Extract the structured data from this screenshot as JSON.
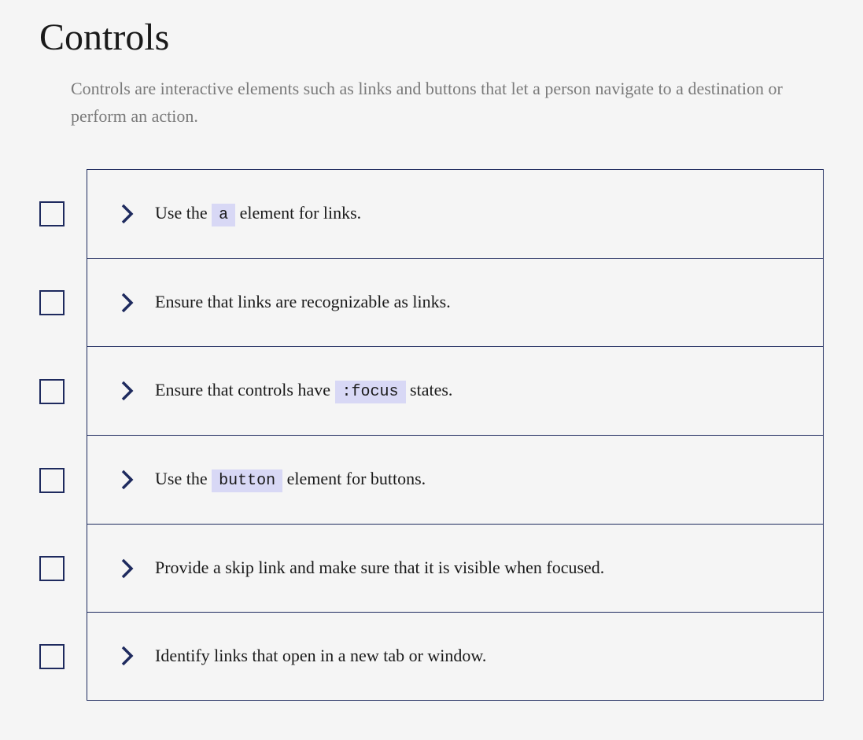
{
  "heading": "Controls",
  "description": "Controls are interactive elements such as links and buttons that let a person navigate to a destination or perform an action.",
  "items": [
    {
      "segments": [
        {
          "t": "text",
          "v": "Use the "
        },
        {
          "t": "code",
          "v": "a"
        },
        {
          "t": "text",
          "v": " element for links."
        }
      ]
    },
    {
      "segments": [
        {
          "t": "text",
          "v": "Ensure that links are recognizable as links."
        }
      ]
    },
    {
      "segments": [
        {
          "t": "text",
          "v": "Ensure that controls have "
        },
        {
          "t": "code",
          "v": ":focus"
        },
        {
          "t": "text",
          "v": " states."
        }
      ]
    },
    {
      "segments": [
        {
          "t": "text",
          "v": "Use the "
        },
        {
          "t": "code",
          "v": "button"
        },
        {
          "t": "text",
          "v": " element for buttons."
        }
      ]
    },
    {
      "segments": [
        {
          "t": "text",
          "v": "Provide a skip link and make sure that it is visible when focused."
        }
      ]
    },
    {
      "segments": [
        {
          "t": "text",
          "v": "Identify links that open in a new tab or window."
        }
      ]
    }
  ]
}
